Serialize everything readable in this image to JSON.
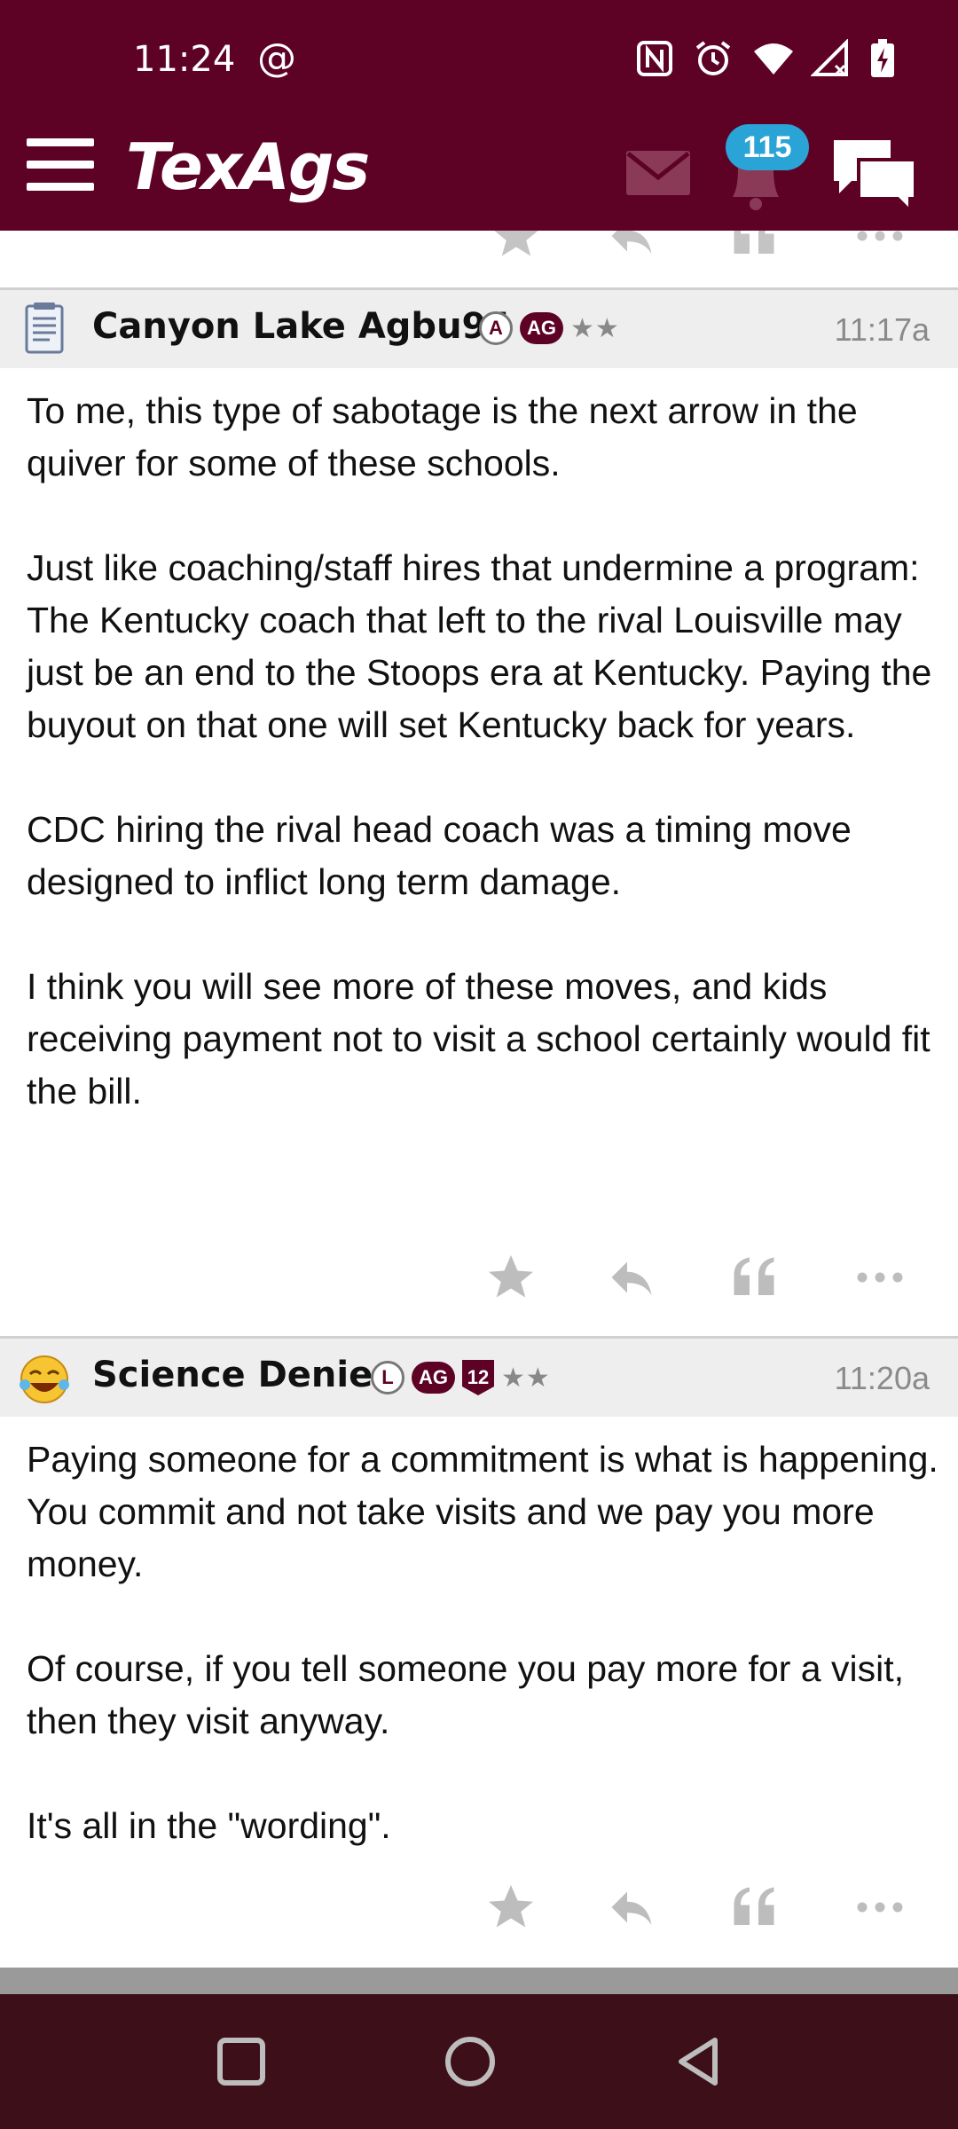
{
  "status_bar": {
    "time": "11:24",
    "at_symbol": "@",
    "icons": [
      "nfc-icon",
      "alarm-icon",
      "wifi-icon",
      "signal-icon",
      "battery-charging-icon"
    ]
  },
  "header": {
    "logo": "TexAgs",
    "notification_count": "115"
  },
  "posts": [
    {
      "username": "Canyon Lake Agbu94",
      "badges": [
        "A",
        "AG"
      ],
      "stars": "★★",
      "time": "11:17a",
      "body": "To me, this type of sabotage is the next arrow in the quiver for some of these schools.\n\nJust like coaching/staff hires that undermine a program:\nThe Kentucky coach that left to the rival Louisville may just be an end to the Stoops era at Kentucky. Paying the buyout on that one will set Kentucky back for years.\n\nCDC hiring the rival head coach was a timing move designed to inflict long term damage.\n\nI think you will see more of these moves, and kids receiving payment not to visit a school certainly would fit the bill."
    },
    {
      "username": "Science Denier",
      "badges": [
        "L",
        "AG",
        "12"
      ],
      "stars": "★★",
      "time": "11:20a",
      "body": "Paying someone for a commitment is what is happening. You commit and not take visits and we pay you more money.\n\nOf course, if you tell someone you pay more for a visit, then they visit anyway.\n\nIt's all in the \"wording\"."
    }
  ],
  "colors": {
    "brand": "#5e0225",
    "badge_blue": "#2aa3d6",
    "nav_bg": "#3c0f19",
    "action_gray": "#b5b5b5"
  }
}
